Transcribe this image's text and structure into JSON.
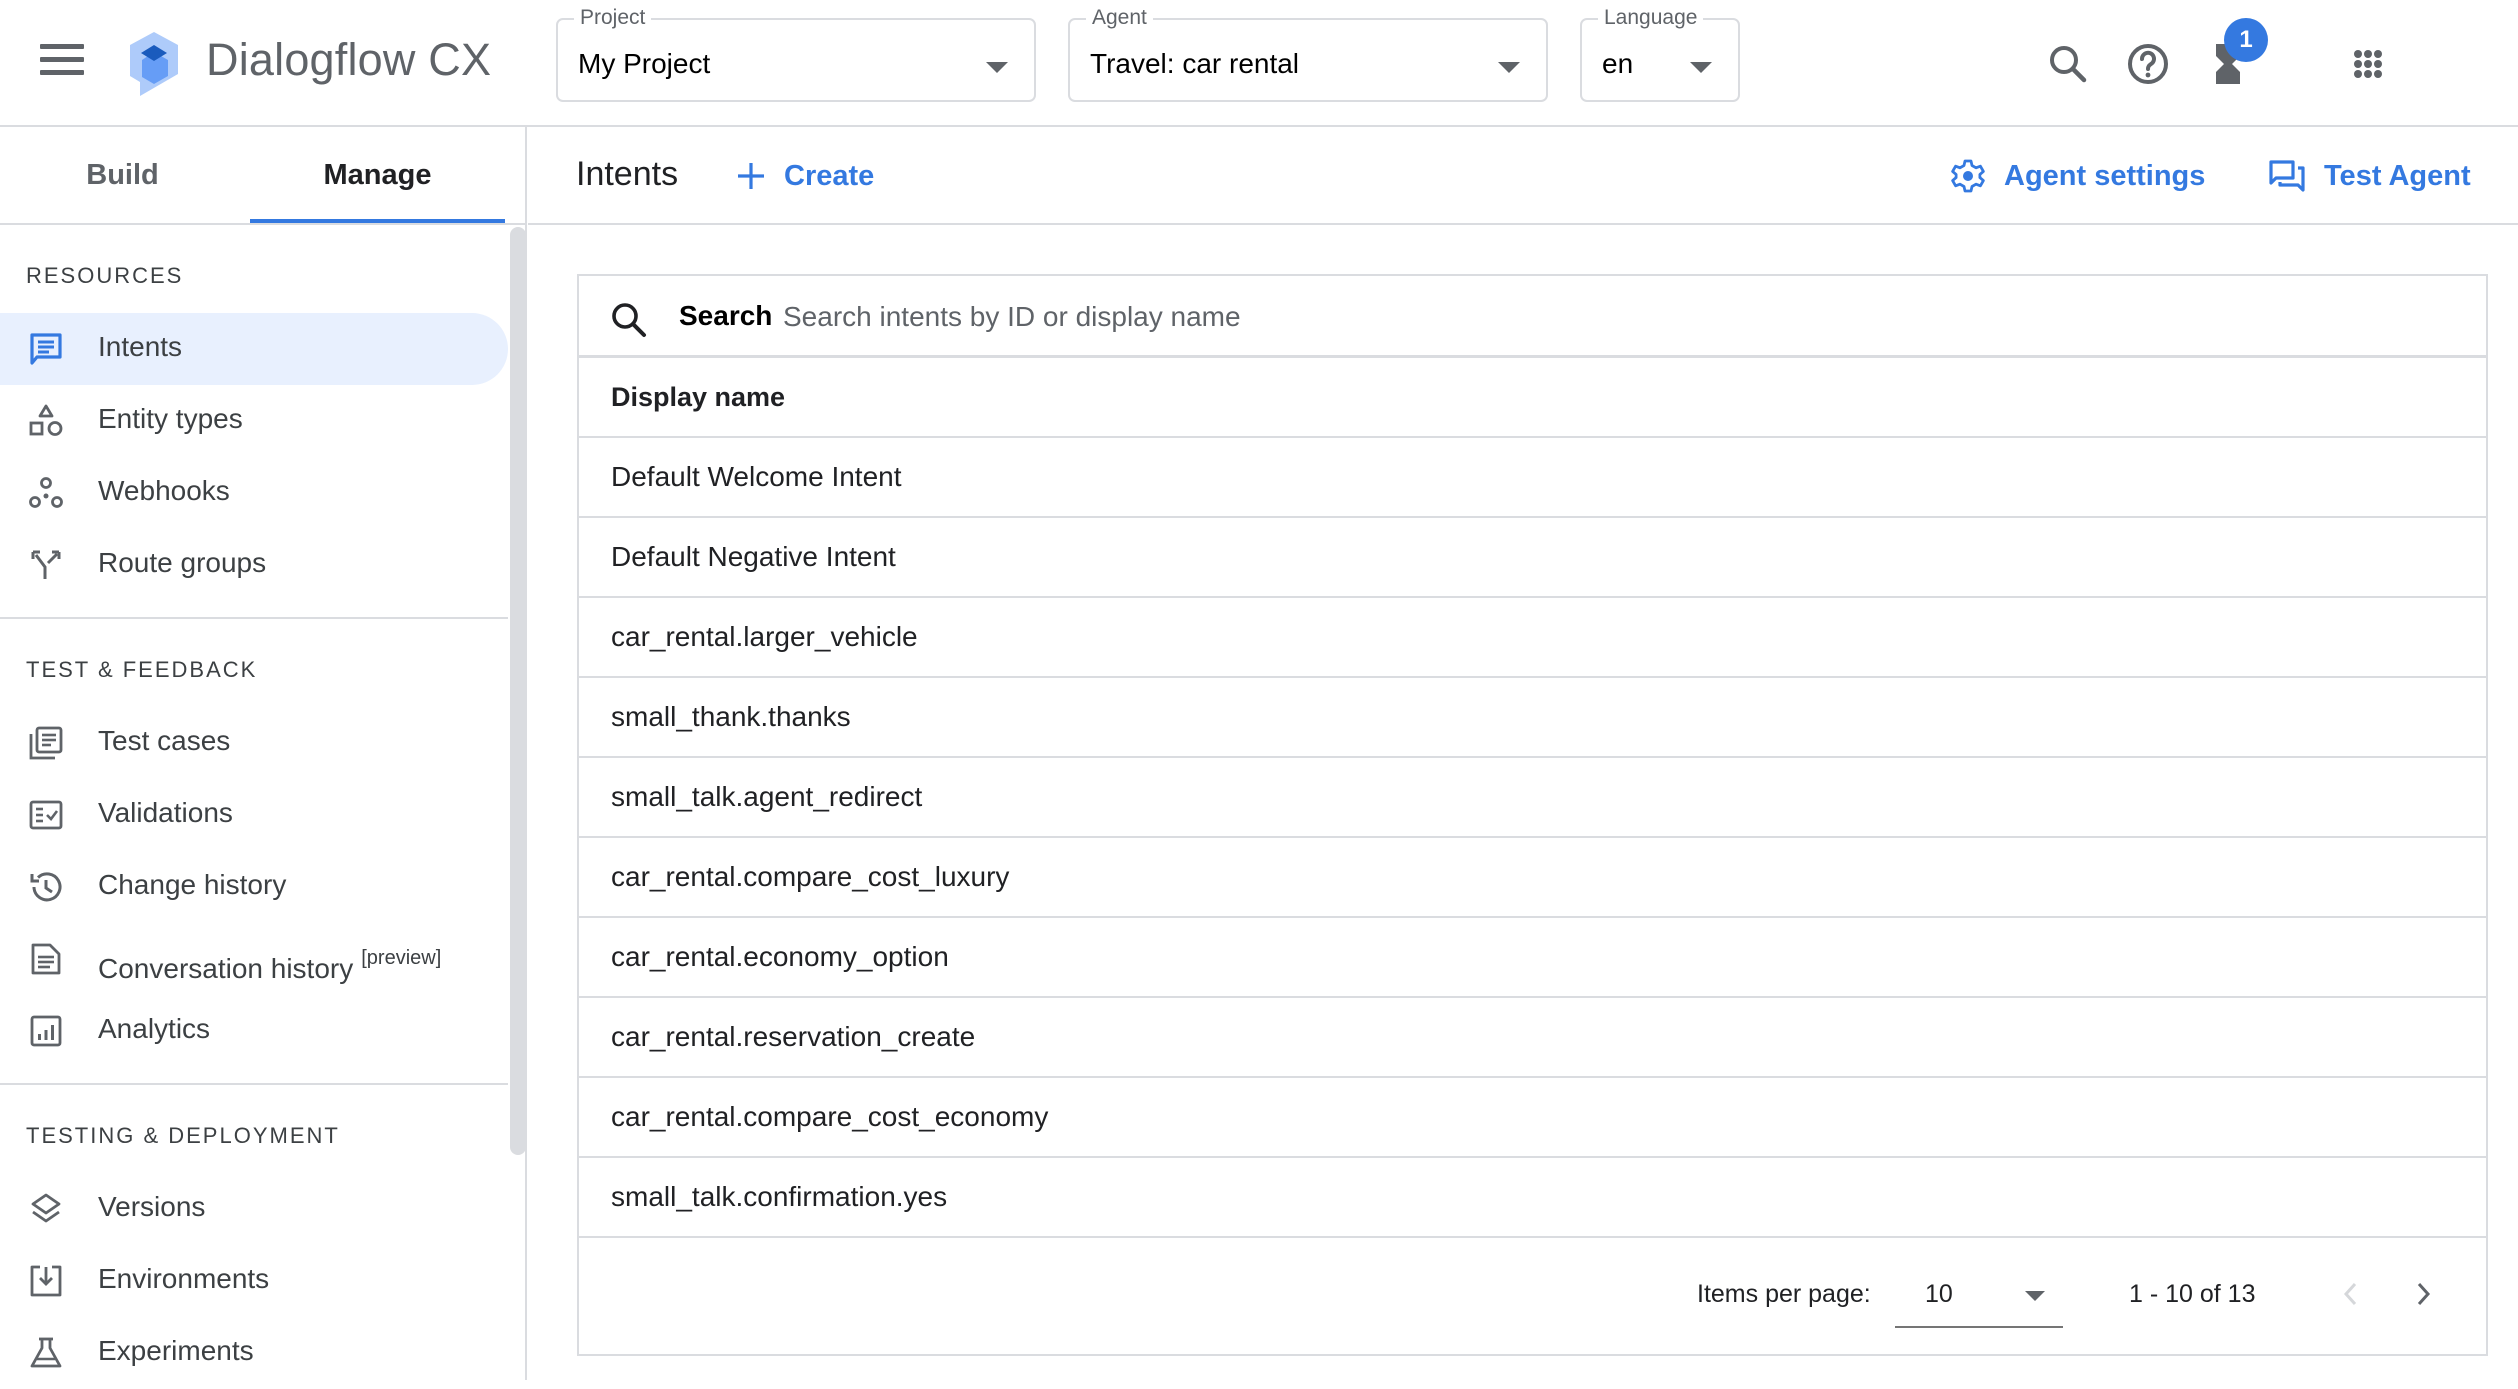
{
  "app": {
    "title": "Dialogflow CX"
  },
  "header": {
    "project": {
      "label": "Project",
      "value": "My Project"
    },
    "agent": {
      "label": "Agent",
      "value": "Travel: car rental"
    },
    "language": {
      "label": "Language",
      "value": "en"
    },
    "icons": [
      "search-icon",
      "help-icon",
      "hourglass-icon",
      "apps-grid-icon"
    ],
    "notification_count": "1",
    "accent_color": "#3479e0"
  },
  "sidebar": {
    "tabs": [
      {
        "label": "Build",
        "active": false
      },
      {
        "label": "Manage",
        "active": true
      }
    ],
    "sections": [
      {
        "title": "RESOURCES",
        "items": [
          {
            "label": "Intents",
            "icon": "intent-icon",
            "active": true
          },
          {
            "label": "Entity types",
            "icon": "entity-types-icon"
          },
          {
            "label": "Webhooks",
            "icon": "webhooks-icon"
          },
          {
            "label": "Route groups",
            "icon": "route-groups-icon"
          }
        ]
      },
      {
        "title": "TEST & FEEDBACK",
        "items": [
          {
            "label": "Test cases",
            "icon": "test-cases-icon"
          },
          {
            "label": "Validations",
            "icon": "validations-icon"
          },
          {
            "label": "Change history",
            "icon": "history-icon"
          },
          {
            "label": "Conversation history",
            "icon": "document-icon",
            "suffix": "[preview]"
          },
          {
            "label": "Analytics",
            "icon": "analytics-icon"
          }
        ]
      },
      {
        "title": "TESTING & DEPLOYMENT",
        "items": [
          {
            "label": "Versions",
            "icon": "layers-icon"
          },
          {
            "label": "Environments",
            "icon": "environments-icon"
          },
          {
            "label": "Experiments",
            "icon": "flask-icon"
          }
        ]
      }
    ]
  },
  "main": {
    "title": "Intents",
    "create_label": "Create",
    "agent_settings_label": "Agent settings",
    "test_agent_label": "Test Agent",
    "search": {
      "label": "Search",
      "placeholder": "Search intents by ID or display name",
      "value": ""
    },
    "table": {
      "columns": [
        "Display name"
      ],
      "rows": [
        "Default Welcome Intent",
        "Default Negative Intent",
        "car_rental.larger_vehicle",
        "small_thank.thanks",
        "small_talk.agent_redirect",
        "car_rental.compare_cost_luxury",
        "car_rental.economy_option",
        "car_rental.reservation_create",
        "car_rental.compare_cost_economy",
        "small_talk.confirmation.yes"
      ]
    },
    "pagination": {
      "items_per_page_label": "Items per page:",
      "items_per_page": "10",
      "range": "1 - 10 of 13",
      "prev_enabled": false,
      "next_enabled": true
    }
  }
}
